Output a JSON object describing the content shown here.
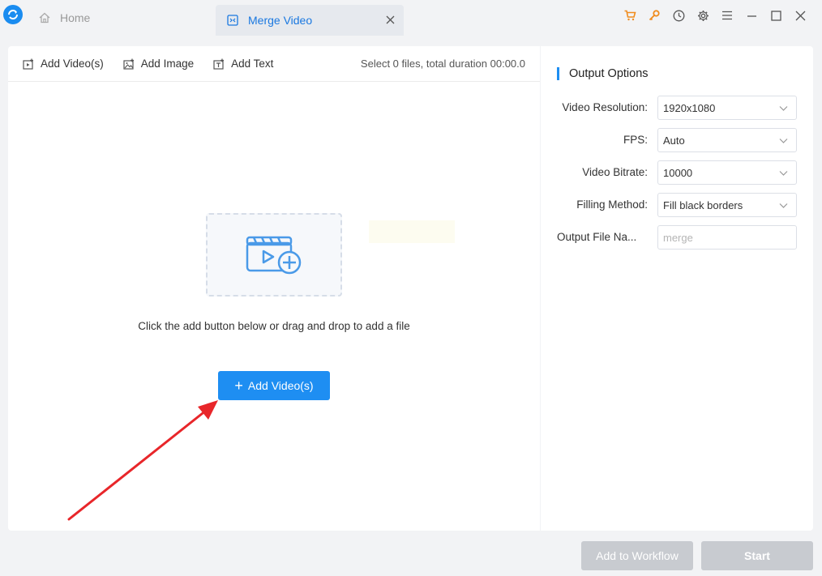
{
  "tabs": {
    "home_label": "Home",
    "merge_label": "Merge Video"
  },
  "toolbar": {
    "add_videos": "Add Video(s)",
    "add_image": "Add Image",
    "add_text": "Add Text",
    "summary": "Select 0 files, total duration 00:00.0"
  },
  "dropzone": {
    "hint": "Click the add button below or drag and drop to add a file",
    "add_button": "Add Video(s)"
  },
  "options": {
    "title": "Output Options",
    "resolution_label": "Video Resolution:",
    "resolution_value": "1920x1080",
    "fps_label": "FPS:",
    "fps_value": "Auto",
    "bitrate_label": "Video Bitrate:",
    "bitrate_value": "10000",
    "filling_label": "Filling Method:",
    "filling_value": "Fill black borders",
    "filename_label": "Output File Na...",
    "filename_placeholder": "merge"
  },
  "actions": {
    "workflow": "Add to Workflow",
    "start": "Start"
  },
  "colors": {
    "accent": "#1e8ef2",
    "cart": "#f08c1e",
    "annotation_arrow": "#e8262a",
    "disabled": "#c8cbd0"
  },
  "icons": [
    "app-logo-icon",
    "home-icon",
    "merge-icon",
    "close-icon",
    "cart-icon",
    "key-icon",
    "history-icon",
    "gear-icon",
    "menu-icon",
    "minimize-icon",
    "maximize-icon",
    "window-close-icon",
    "add-video-icon",
    "add-image-icon",
    "add-text-icon",
    "video-add-icon",
    "chevron-down-icon"
  ]
}
